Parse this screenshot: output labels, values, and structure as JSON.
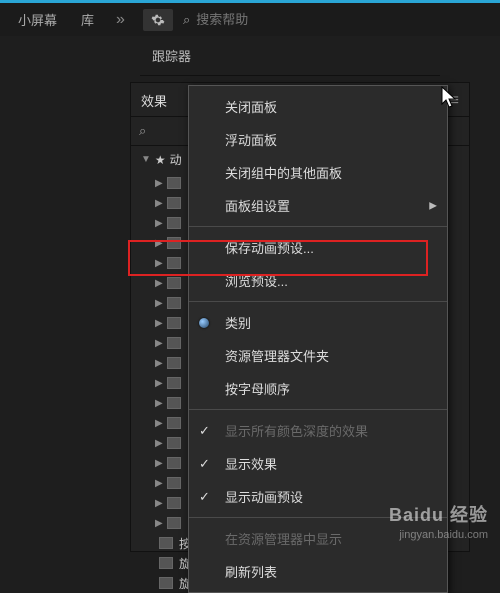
{
  "topbar": {
    "tab_small_screen": "小屏幕",
    "tab_library": "库",
    "search_placeholder": "搜索帮助"
  },
  "tracker": {
    "title": "跟踪器"
  },
  "panel": {
    "tab_label": "效果",
    "tree_root": "动",
    "rows": [
      "按字符淡入",
      "旋转出每个单词",
      "旋转出每行"
    ]
  },
  "menu": {
    "close_panel": "关闭面板",
    "float_panel": "浮动面板",
    "close_other_panels": "关闭组中的其他面板",
    "panel_group_settings": "面板组设置",
    "save_preset": "保存动画预设...",
    "browse_preset": "浏览预设...",
    "categories": "类别",
    "explorer_folder": "资源管理器文件夹",
    "alphabetical": "按字母顺序",
    "show_all_color_depth": "显示所有颜色深度的效果",
    "show_effects": "显示效果",
    "show_anim_presets": "显示动画预设",
    "reveal_in_explorer": "在资源管理器中显示",
    "refresh_list": "刷新列表"
  },
  "watermark": {
    "brand": "Bai﻿du 经验",
    "url": "jingyan.baidu.com"
  }
}
